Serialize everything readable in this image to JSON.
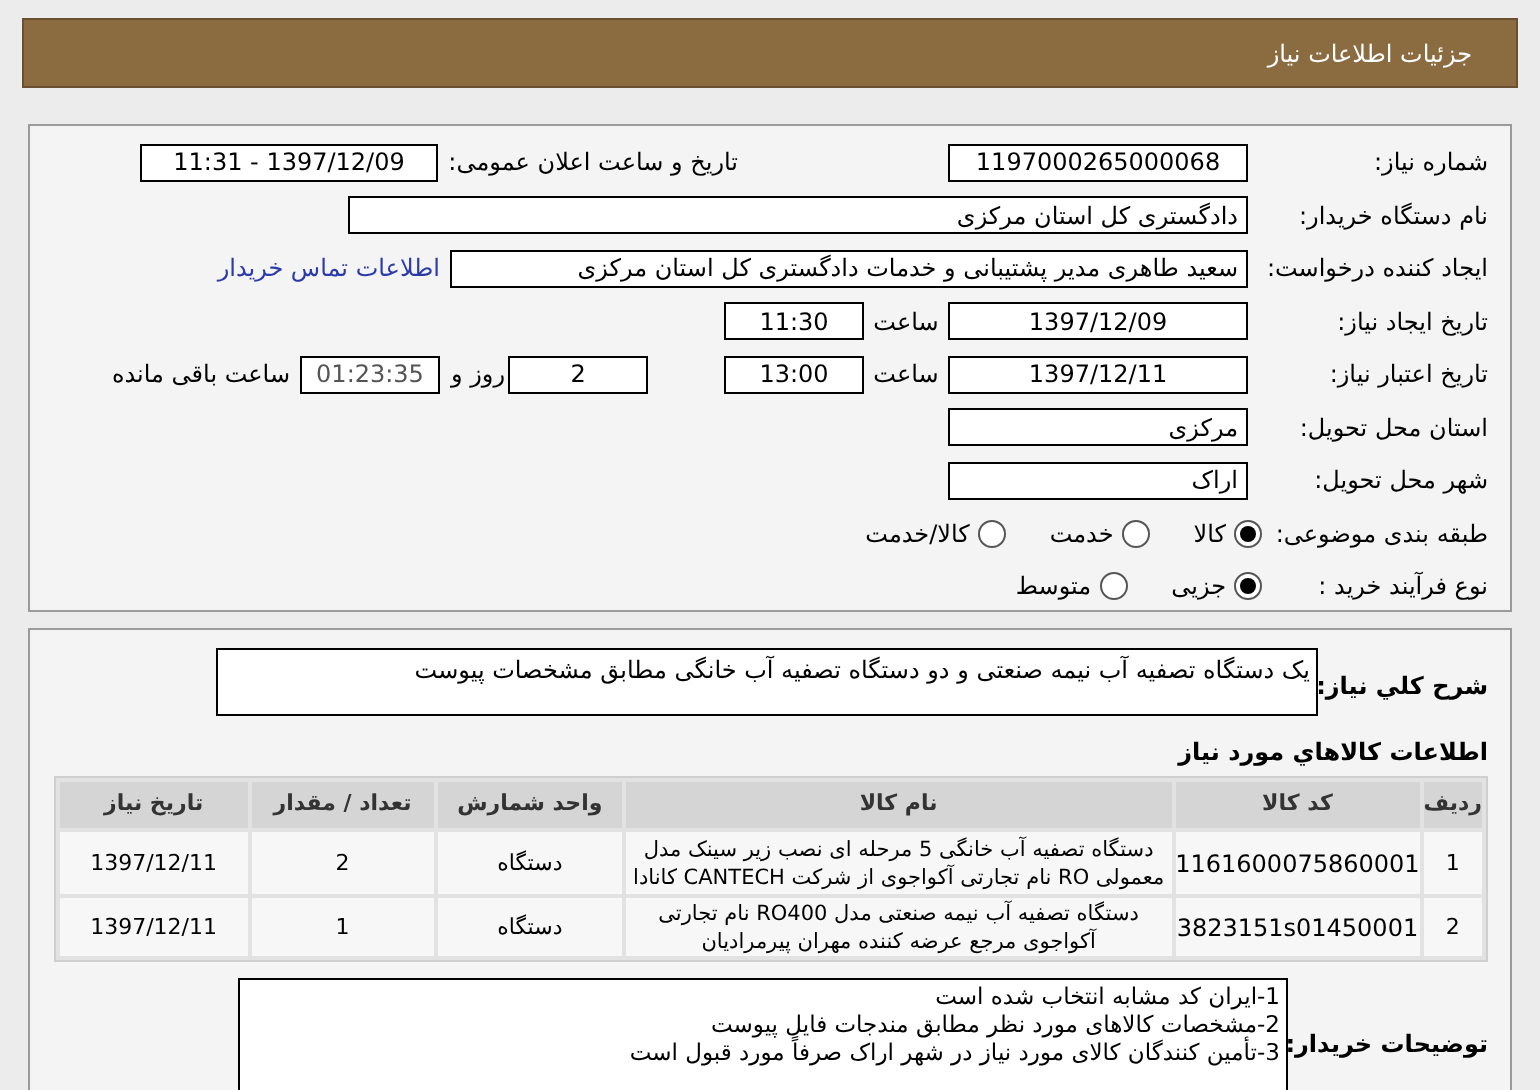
{
  "header": {
    "title": "جزئیات اطلاعات نیاز"
  },
  "need_info": {
    "need_number": {
      "label": "شماره نیاز:",
      "value": "1197000265000068"
    },
    "announce": {
      "label": "تاریخ و ساعت اعلان عمومی:",
      "value": "1397/12/09 - 11:31"
    },
    "buyer_org": {
      "label": "نام دستگاه خریدار:",
      "value": "دادگستری کل استان مرکزی"
    },
    "requester": {
      "label": "ایجاد کننده درخواست:",
      "value": "سعید طاهری مدیر پشتیبانی و خدمات دادگستری کل استان مرکزی",
      "link": "اطلاعات تماس خریدار"
    },
    "created": {
      "label": "تاریخ ایجاد نیاز:",
      "date": "1397/12/09",
      "time_label": "ساعت",
      "time": "11:30"
    },
    "valid": {
      "label": "تاریخ اعتبار نیاز:",
      "date": "1397/12/11",
      "time_label": "ساعت",
      "time": "13:00",
      "days": "2",
      "days_label": "روز و",
      "remaining": "01:23:35",
      "remaining_label": "ساعت باقی مانده"
    },
    "province": {
      "label": "استان محل تحویل:",
      "value": "مرکزی"
    },
    "city": {
      "label": "شهر محل تحویل:",
      "value": "اراک"
    },
    "category": {
      "label": "طبقه بندی موضوعی:",
      "options": [
        {
          "label": "کالا",
          "selected": true
        },
        {
          "label": "خدمت",
          "selected": false
        },
        {
          "label": "کالا/خدمت",
          "selected": false
        }
      ]
    },
    "process": {
      "label": "نوع فرآیند خرید :",
      "options": [
        {
          "label": "جزیی",
          "selected": true
        },
        {
          "label": "متوسط",
          "selected": false
        }
      ]
    }
  },
  "summary": {
    "label": "شرح کلي نياز:",
    "text": "یک دستگاه تصفیه آب نیمه صنعتی  و دو دستگاه تصفیه آب خانگی مطابق مشخصات پیوست"
  },
  "items": {
    "title": "اطلاعات کالاهاي مورد نياز",
    "columns": [
      "ردیف",
      "کد کالا",
      "نام کالا",
      "واحد شمارش",
      "تعداد / مقدار",
      "تاریخ نیاز"
    ],
    "rows": [
      [
        "1",
        "1161600075860001",
        "دستگاه تصفیه آب خانگی 5 مرحله ای نصب زیر سینک مدل معمولی RO نام تجارتی آکواجوی از شرکت CANTECH کانادا",
        "دستگاه",
        "2",
        "1397/12/11"
      ],
      [
        "2",
        "3823151s01450001",
        "دستگاه تصفیه آب نیمه صنعتی مدل RO400 نام تجارتی آکواجوی مرجع عرضه کننده مهران پیرمرادیان",
        "دستگاه",
        "1",
        "1397/12/11"
      ]
    ]
  },
  "buyer_notes": {
    "label": "توضیحات خریدار:",
    "lines": [
      "1-ایران کد مشابه انتخاب شده است",
      "2-مشخصات کالاهای مورد نظر مطابق مندجات فایل پیوست",
      "3-تأمین کنندگان کالای مورد نیاز در شهر  اراک  صرفاً مورد قبول است"
    ]
  }
}
